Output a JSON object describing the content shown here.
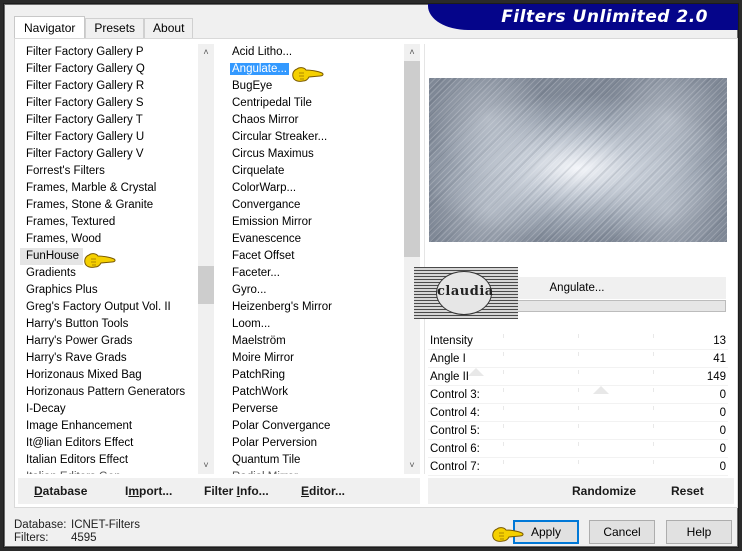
{
  "window": {
    "title": "Filters Unlimited 2.0"
  },
  "tabs": [
    {
      "label": "Navigator",
      "active": true
    },
    {
      "label": "Presets",
      "active": false
    },
    {
      "label": "About",
      "active": false
    }
  ],
  "categories": {
    "items": [
      "Filter Factory Gallery P",
      "Filter Factory Gallery Q",
      "Filter Factory Gallery R",
      "Filter Factory Gallery S",
      "Filter Factory Gallery T",
      "Filter Factory Gallery U",
      "Filter Factory Gallery V",
      "Forrest's Filters",
      "Frames, Marble & Crystal",
      "Frames, Stone & Granite",
      "Frames, Textured",
      "Frames, Wood",
      "FunHouse",
      "Gradients",
      "Graphics Plus",
      "Greg's Factory Output Vol. II",
      "Harry's Button Tools",
      "Harry's Power Grads",
      "Harry's Rave Grads",
      "Horizonaus Mixed Bag",
      "Horizonaus Pattern Generators",
      "I-Decay",
      "Image Enhancement",
      "It@lian Editors Effect",
      "Italian Editors Effect",
      "Italian Editors Gen..."
    ],
    "selected": "FunHouse",
    "scroll_position_fraction": 0.52
  },
  "filters": {
    "items": [
      "Acid Litho...",
      "Angulate...",
      "BugEye",
      "Centripedal Tile",
      "Chaos Mirror",
      "Circular Streaker...",
      "Circus Maximus",
      "Cirquelate",
      "ColorWarp...",
      "Convergance",
      "Emission Mirror",
      "Evanescence",
      "Facet Offset",
      "Faceter...",
      "Gyro...",
      "Heizenberg's Mirror",
      "Loom...",
      "Maelström",
      "Moire Mirror",
      "PatchRing",
      "PatchWork",
      "Perverse",
      "Polar Convergance",
      "Polar Perversion",
      "Quantum Tile",
      "Radial Mirror"
    ],
    "selected": "Angulate...",
    "scroll_position_fraction": 0.0
  },
  "preview": {
    "filter_name": "Angulate...",
    "watermark": "claudia"
  },
  "controls": [
    {
      "label": "Intensity",
      "value": 13
    },
    {
      "label": "Angle I",
      "value": 41
    },
    {
      "label": "Angle II",
      "value": 149
    },
    {
      "label": "Control 3:",
      "value": 0
    },
    {
      "label": "Control 4:",
      "value": 0
    },
    {
      "label": "Control 5:",
      "value": 0
    },
    {
      "label": "Control 6:",
      "value": 0
    },
    {
      "label": "Control 7:",
      "value": 0
    }
  ],
  "toolbar": {
    "database": {
      "pre": "",
      "ul": "D",
      "post": "atabase"
    },
    "import": {
      "pre": "I",
      "ul": "m",
      "post": "port..."
    },
    "filter_info": {
      "pre": "Filter ",
      "ul": "I",
      "post": "nfo..."
    },
    "editor": {
      "pre": "",
      "ul": "E",
      "post": "ditor..."
    },
    "randomize": "Randomize",
    "reset": "Reset"
  },
  "status": {
    "database_label": "Database:",
    "database_value": "ICNET-Filters",
    "filters_label": "Filters:",
    "filters_value": "4595"
  },
  "buttons": {
    "apply": "Apply",
    "cancel": "Cancel",
    "help": "Help"
  },
  "icons": {
    "pointer": "pointing-hand-icon",
    "scroll_up": "chevron-up-icon",
    "scroll_down": "chevron-down-icon"
  },
  "colors": {
    "title_banner": "#05058a",
    "selection": "#3399ff",
    "default_button_border": "#0078d7",
    "pointer_hand": "#f5d000"
  }
}
